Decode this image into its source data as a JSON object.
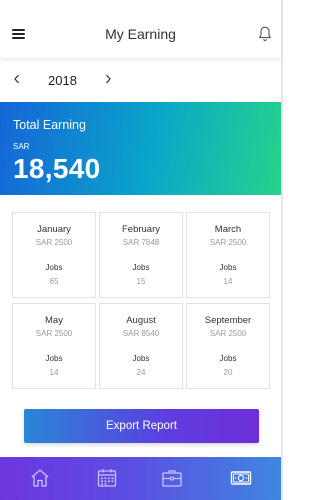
{
  "header": {
    "title": "My Earning"
  },
  "year_selector": {
    "year": "2018"
  },
  "total": {
    "title": "Total Earning",
    "currency": "SAR",
    "amount": "18,540"
  },
  "months": [
    {
      "name": "January",
      "amount": "SAR 2500",
      "jobs_label": "Jobs",
      "jobs": "65"
    },
    {
      "name": "February",
      "amount": "SAR 7848",
      "jobs_label": "Jobs",
      "jobs": "15"
    },
    {
      "name": "March",
      "amount": "SAR 2500",
      "jobs_label": "Jobs",
      "jobs": "14"
    },
    {
      "name": "May",
      "amount": "SAR 2500",
      "jobs_label": "Jobs",
      "jobs": "14"
    },
    {
      "name": "August",
      "amount": "SAR 8540",
      "jobs_label": "Jobs",
      "jobs": "24"
    },
    {
      "name": "September",
      "amount": "SAR 2500",
      "jobs_label": "Jobs",
      "jobs": "20"
    }
  ],
  "export_button": {
    "label": "Export Report"
  },
  "bottom_nav": [
    {
      "icon": "home-icon"
    },
    {
      "icon": "calendar-icon"
    },
    {
      "icon": "briefcase-icon"
    },
    {
      "icon": "money-icon",
      "active": true
    }
  ],
  "colors": {
    "card_gradient_start": "#1565d8",
    "card_gradient_end": "#27d38a",
    "button_gradient_start": "#2a86d6",
    "button_gradient_end": "#6e2ed8",
    "nav_gradient_start": "#6d35e0",
    "nav_gradient_end": "#3f86e0"
  }
}
